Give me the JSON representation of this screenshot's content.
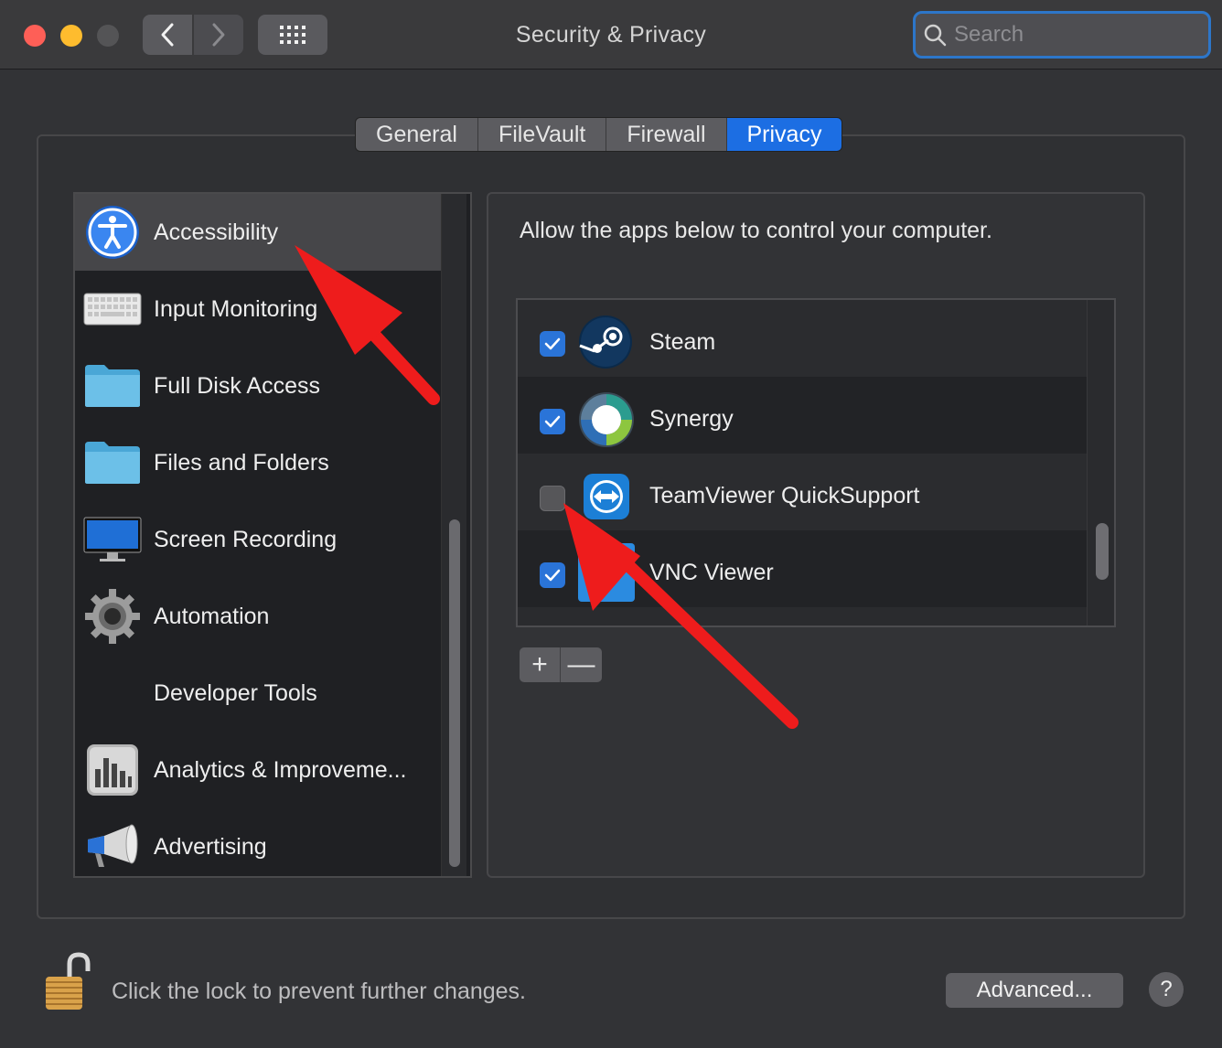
{
  "window": {
    "title": "Security & Privacy",
    "search_placeholder": "Search"
  },
  "tabs": [
    {
      "label": "General",
      "active": false
    },
    {
      "label": "FileVault",
      "active": false
    },
    {
      "label": "Firewall",
      "active": false
    },
    {
      "label": "Privacy",
      "active": true
    }
  ],
  "categories": [
    {
      "label": "Accessibility",
      "icon": "accessibility-icon",
      "selected": true
    },
    {
      "label": "Input Monitoring",
      "icon": "keyboard-icon",
      "selected": false
    },
    {
      "label": "Full Disk Access",
      "icon": "folder-icon",
      "selected": false
    },
    {
      "label": "Files and Folders",
      "icon": "folder-icon",
      "selected": false
    },
    {
      "label": "Screen Recording",
      "icon": "display-icon",
      "selected": false
    },
    {
      "label": "Automation",
      "icon": "gear-icon",
      "selected": false
    },
    {
      "label": "Developer Tools",
      "icon": "",
      "selected": false
    },
    {
      "label": "Analytics & Improveme...",
      "icon": "analytics-icon",
      "selected": false
    },
    {
      "label": "Advertising",
      "icon": "megaphone-icon",
      "selected": false
    }
  ],
  "panel": {
    "description": "Allow the apps below to control your computer.",
    "apps": [
      {
        "name": "Steam",
        "checked": true,
        "icon": "steam-icon"
      },
      {
        "name": "Synergy",
        "checked": true,
        "icon": "synergy-icon"
      },
      {
        "name": "TeamViewer QuickSupport",
        "checked": false,
        "icon": "teamviewer-icon"
      },
      {
        "name": "VNC Viewer",
        "checked": true,
        "icon": "vnc-viewer-icon"
      }
    ],
    "add_label": "+",
    "remove_label": "—"
  },
  "footer": {
    "lock_text": "Click the lock to prevent further changes.",
    "advanced_label": "Advanced...",
    "help_label": "?"
  },
  "colors": {
    "accent": "#1c6ee3",
    "annotation_arrow": "#ee1c1c"
  }
}
